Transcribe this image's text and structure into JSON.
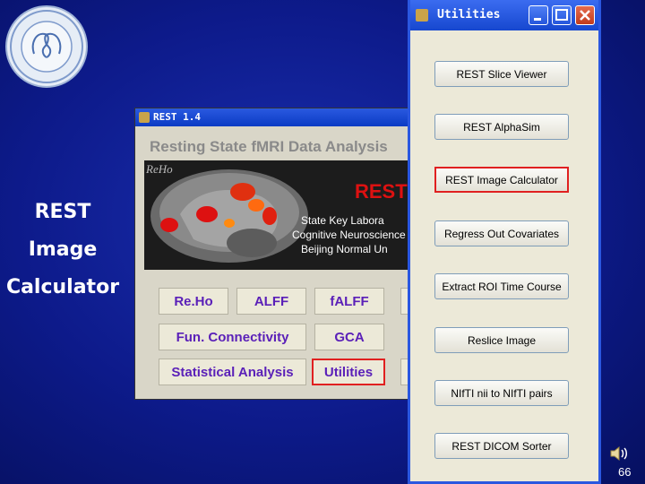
{
  "slide": {
    "side_title_lines": [
      "REST",
      "Image",
      "Calculator"
    ],
    "page_number": "66"
  },
  "rest_window": {
    "title": "REST 1.4",
    "header": "Resting State fMRI Data Analysis",
    "brain_logo_text": "ReHo",
    "brain_title": "REST",
    "brain_lines": [
      "State Key Labora",
      "Cognitive Neuroscience",
      "Beijing Normal Un"
    ],
    "buttons": [
      "Re.Ho",
      "ALFF",
      "fALFF",
      "Fun. Connectivity",
      "GCA",
      "Statistical Analysis",
      "Utilities"
    ]
  },
  "utilities_window": {
    "title": "Utilities",
    "buttons": [
      "REST Slice Viewer",
      "REST AlphaSim",
      "REST Image Calculator",
      "Regress Out Covariates",
      "Extract ROI Time Course",
      "Reslice Image",
      "NIfTI nii to NIfTI pairs",
      "REST DICOM Sorter"
    ]
  },
  "colors": {
    "background": "#0d1a8a",
    "highlight": "#e02020",
    "rest_button_text": "#5a1fb8",
    "titlebar": "#1647cf"
  }
}
